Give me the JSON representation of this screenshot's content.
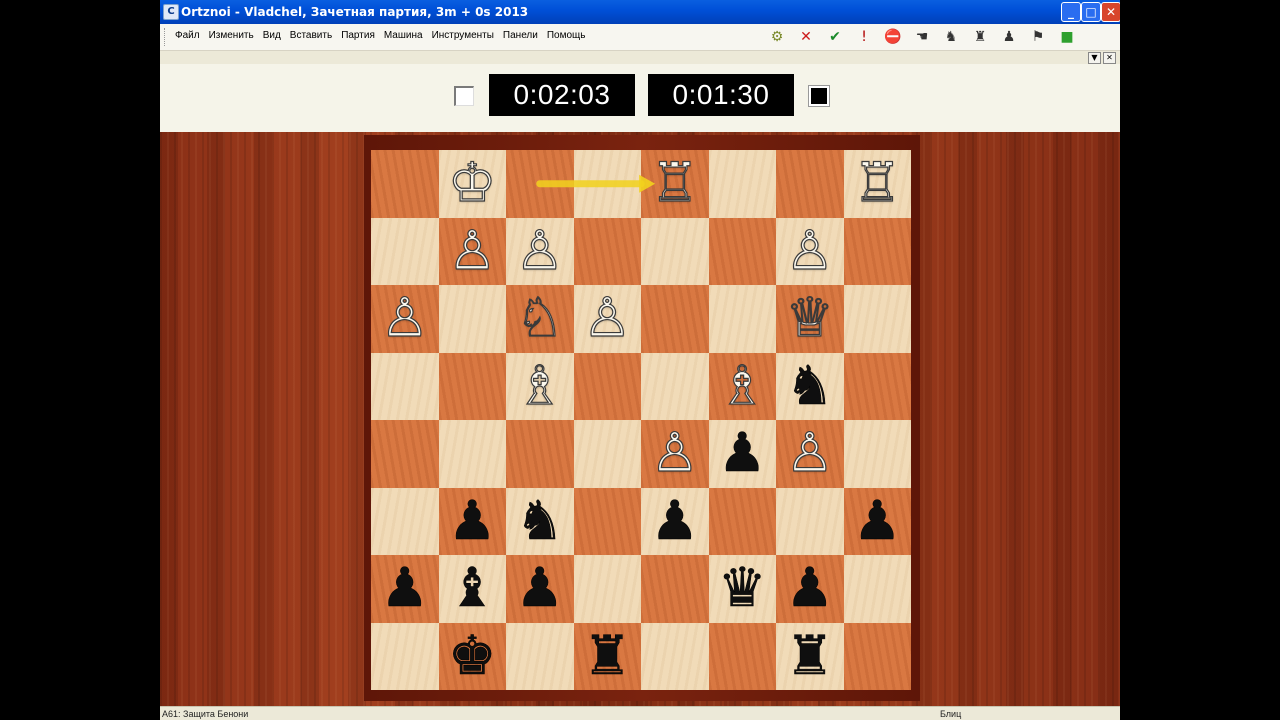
{
  "window": {
    "title": "Ortznoi - Vladchel, Зачетная партия, 3m + 0s 2013",
    "icon_label": "C",
    "controls": {
      "minimize": "_",
      "maximize": "□",
      "close": "✕"
    }
  },
  "menu": {
    "items": [
      "Файл",
      "Изменить",
      "Вид",
      "Вставить",
      "Партия",
      "Машина",
      "Инструменты",
      "Панели",
      "Помощь"
    ]
  },
  "toolbar": {
    "buttons": [
      {
        "name": "engine-icon",
        "glyph": "⚙",
        "color": "#7a8a2a"
      },
      {
        "name": "cancel-icon",
        "glyph": "✕",
        "color": "#cc1a1a"
      },
      {
        "name": "accept-icon",
        "glyph": "✔",
        "color": "#1a8a2a"
      },
      {
        "name": "exclamation-icon",
        "glyph": "!",
        "color": "#b00000"
      },
      {
        "name": "stop-icon",
        "glyph": "⛔",
        "color": "#d00000"
      },
      {
        "name": "hand-icon",
        "glyph": "☚",
        "color": "#333333"
      },
      {
        "name": "pieces-icon",
        "glyph": "♞",
        "color": "#333333"
      },
      {
        "name": "board-icon",
        "glyph": "♜",
        "color": "#333333"
      },
      {
        "name": "players-icon",
        "glyph": "♟",
        "color": "#333333"
      },
      {
        "name": "flag-icon",
        "glyph": "⚑",
        "color": "#333333"
      },
      {
        "name": "green-square-icon",
        "glyph": "■",
        "color": "#2ea02e"
      }
    ],
    "panel_controls": [
      "▼",
      "✕"
    ]
  },
  "clocks": {
    "white_time": "0:02:03",
    "black_time": "0:01:30"
  },
  "board": {
    "colors": {
      "light": "#f1dbb8",
      "dark": "#d97842",
      "arrow": "#f2d21e"
    },
    "pieces": [
      {
        "sq": "b8",
        "color": "w",
        "type": "K"
      },
      {
        "sq": "e8",
        "color": "w",
        "type": "R"
      },
      {
        "sq": "h8",
        "color": "w",
        "type": "R"
      },
      {
        "sq": "b7",
        "color": "w",
        "type": "P"
      },
      {
        "sq": "c7",
        "color": "w",
        "type": "P"
      },
      {
        "sq": "g7",
        "color": "w",
        "type": "P"
      },
      {
        "sq": "a6",
        "color": "w",
        "type": "P"
      },
      {
        "sq": "c6",
        "color": "w",
        "type": "N"
      },
      {
        "sq": "d6",
        "color": "w",
        "type": "P"
      },
      {
        "sq": "g6",
        "color": "w",
        "type": "Q"
      },
      {
        "sq": "c5",
        "color": "w",
        "type": "B"
      },
      {
        "sq": "f5",
        "color": "w",
        "type": "B"
      },
      {
        "sq": "g5",
        "color": "b",
        "type": "N"
      },
      {
        "sq": "e4",
        "color": "w",
        "type": "P"
      },
      {
        "sq": "f4",
        "color": "b",
        "type": "P"
      },
      {
        "sq": "g4",
        "color": "w",
        "type": "P"
      },
      {
        "sq": "b3",
        "color": "b",
        "type": "P"
      },
      {
        "sq": "c3",
        "color": "b",
        "type": "N"
      },
      {
        "sq": "e3",
        "color": "b",
        "type": "P"
      },
      {
        "sq": "h3",
        "color": "b",
        "type": "P"
      },
      {
        "sq": "a2",
        "color": "b",
        "type": "P"
      },
      {
        "sq": "b2",
        "color": "b",
        "type": "B"
      },
      {
        "sq": "c2",
        "color": "b",
        "type": "P"
      },
      {
        "sq": "f2",
        "color": "b",
        "type": "Q"
      },
      {
        "sq": "g2",
        "color": "b",
        "type": "P"
      },
      {
        "sq": "b1",
        "color": "b",
        "type": "K"
      },
      {
        "sq": "d1",
        "color": "b",
        "type": "R"
      },
      {
        "sq": "g1",
        "color": "b",
        "type": "R"
      }
    ],
    "last_move": {
      "from": "c8",
      "to": "e8"
    }
  },
  "status": {
    "left": "A61: Защита Бенони",
    "right": "Блиц"
  }
}
